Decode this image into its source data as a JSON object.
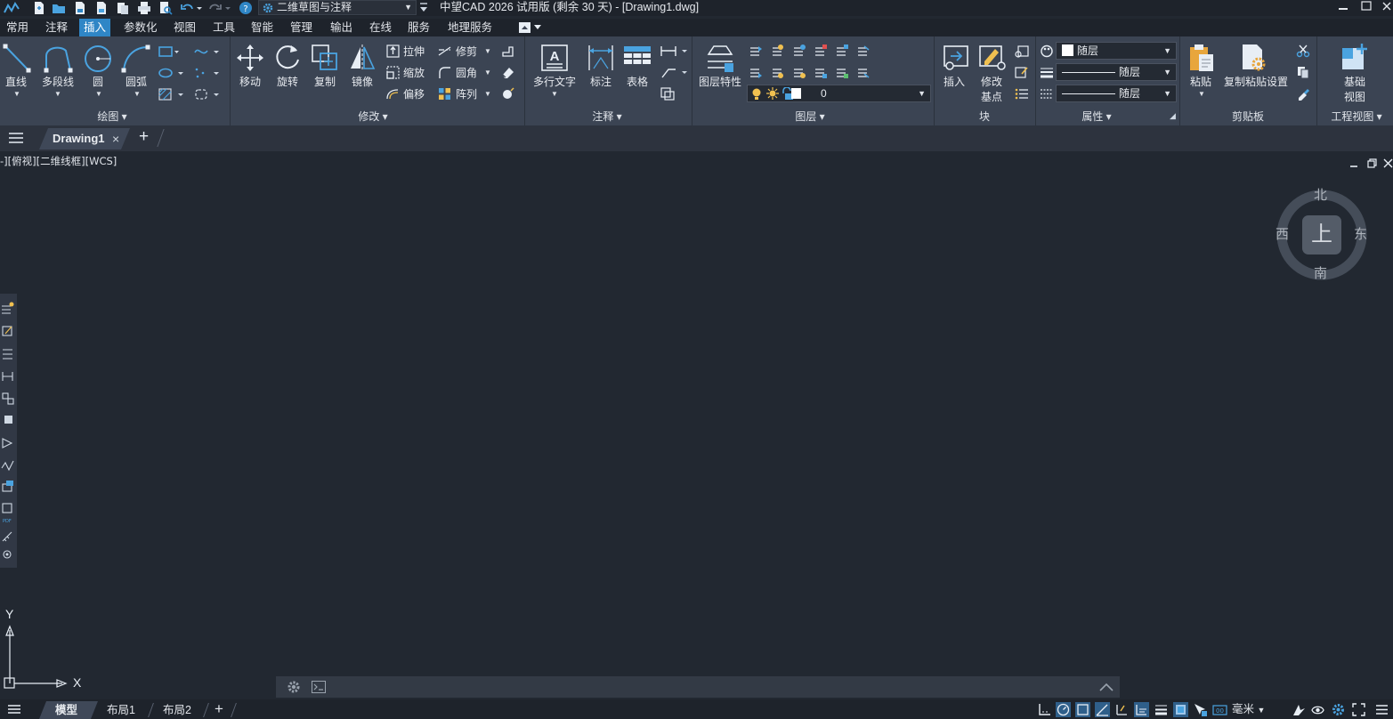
{
  "app": {
    "title": "中望CAD 2026 试用版 (剩余 30 天) - [Drawing1.dwg]",
    "workspace": "二维草图与注释",
    "accent_color": "#2f86c6"
  },
  "menu": {
    "items": [
      "常用",
      "注释",
      "插入",
      "参数化",
      "视图",
      "工具",
      "智能",
      "管理",
      "输出",
      "在线",
      "服务",
      "地理服务"
    ],
    "active": "插入"
  },
  "ribbon": {
    "draw": {
      "title": "绘图",
      "line": "直线",
      "polyline": "多段线",
      "circle": "圆",
      "arc": "圆弧"
    },
    "modify": {
      "title": "修改",
      "move": "移动",
      "rotate": "旋转",
      "copy": "复制",
      "mirror": "镜像",
      "stretch": "拉伸",
      "scale": "缩放",
      "offset": "偏移",
      "trim": "修剪",
      "fillet": "圆角",
      "array": "阵列"
    },
    "annotation": {
      "title": "注释",
      "mtext": "多行文字",
      "dimension": "标注",
      "table": "表格"
    },
    "layers": {
      "title": "图层",
      "layer_props": "图层特性",
      "current_layer": "0"
    },
    "block": {
      "title": "块",
      "insert": "插入",
      "edit_base_line1": "修改",
      "edit_base_line2": "基点"
    },
    "properties": {
      "title": "属性",
      "color": "随层",
      "linetype": "随层",
      "lineweight": "随层"
    },
    "clipboard": {
      "title": "剪贴板",
      "paste": "粘贴",
      "paste_settings": "复制粘贴设置"
    },
    "eng_view": {
      "title": "工程视图",
      "base_view_line1": "基础",
      "base_view_line2": "视图"
    }
  },
  "doc_tabs": {
    "active": "Drawing1",
    "close_glyph": "×",
    "add_glyph": "+"
  },
  "viewport": {
    "label": "-][俯视][二维线框][WCS]",
    "viewcube": {
      "north": "北",
      "south": "南",
      "east": "东",
      "west": "西",
      "center": "上"
    },
    "ucs": {
      "x": "X",
      "y": "Y"
    }
  },
  "layout_tabs": {
    "model": "模型",
    "layout1": "布局1",
    "layout2": "布局2",
    "add_glyph": "+"
  },
  "status": {
    "units": "毫米"
  }
}
